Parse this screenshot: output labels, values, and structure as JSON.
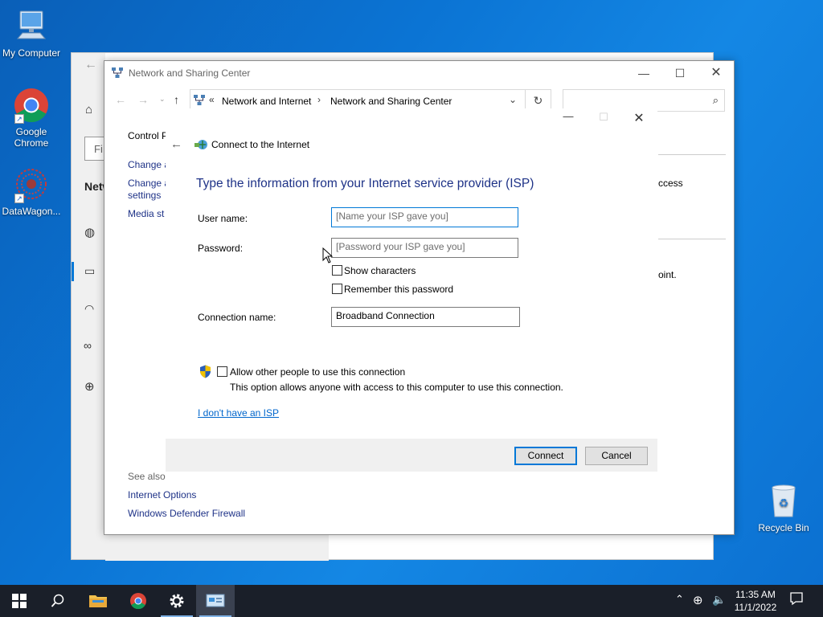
{
  "desktop": {
    "icons": [
      {
        "label": "My Computer"
      },
      {
        "label": "Google Chrome"
      },
      {
        "label": "DataWagon..."
      },
      {
        "label": "Recycle Bin"
      }
    ]
  },
  "background_window": {
    "left_items": [
      "Control P",
      "Change a",
      "Change a\nsettings",
      "Media st"
    ],
    "heading": "Netw",
    "search_partial": "Fi",
    "right_fragments": [
      "ccess",
      "oint."
    ],
    "see_also": "See also",
    "links": [
      "Internet Options",
      "Windows Defender Firewall"
    ]
  },
  "cp_window": {
    "title": "Network and Sharing Center",
    "breadcrumb": {
      "overflow": "«",
      "items": [
        "Network and Internet",
        "Network and Sharing Center"
      ]
    },
    "search_placeholder": ""
  },
  "dialog": {
    "title": "Connect to the Internet",
    "heading": "Type the information from your Internet service provider (ISP)",
    "fields": {
      "username_label": "User name:",
      "username_placeholder": "[Name your ISP gave you]",
      "password_label": "Password:",
      "password_placeholder": "[Password your ISP gave you]",
      "show_characters": "Show characters",
      "remember_password": "Remember this password",
      "connection_label": "Connection name:",
      "connection_value": "Broadband Connection"
    },
    "allow_others": {
      "label": "Allow other people to use this connection",
      "description": "This option allows anyone with access to this computer to use this connection."
    },
    "no_isp_link": "I don't have an ISP",
    "buttons": {
      "connect": "Connect",
      "cancel": "Cancel"
    }
  },
  "taskbar": {
    "time": "11:35 AM",
    "date": "11/1/2022"
  },
  "colors": {
    "accent": "#0078d7",
    "heading_blue": "#1e3287",
    "link_blue": "#0066cc",
    "taskbar": "#1a1f29"
  }
}
